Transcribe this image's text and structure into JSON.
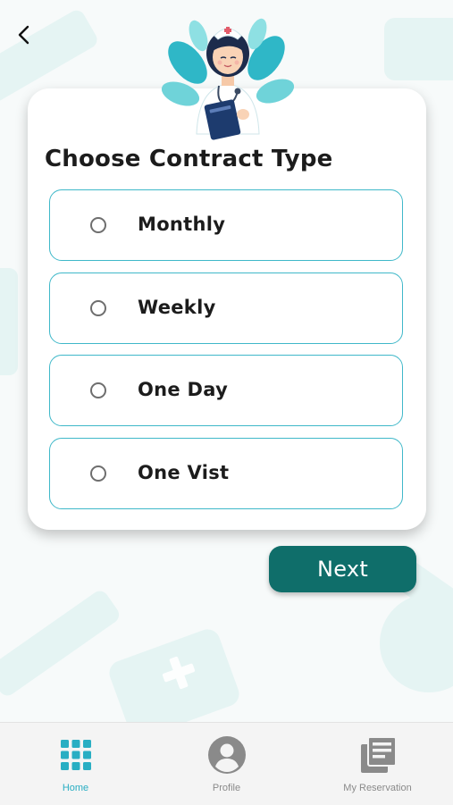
{
  "colors": {
    "accent": "#29aec3",
    "option_border": "#3fb8c9",
    "primary_button": "#0f6e6a",
    "nav_inactive": "#8a8a8a"
  },
  "header": {
    "back_icon": "chevron-left-icon"
  },
  "card": {
    "title": "Choose Contract Type",
    "illustration": "nurse-illustration",
    "options": [
      {
        "label": "Monthly",
        "selected": false
      },
      {
        "label": "Weekly",
        "selected": false
      },
      {
        "label": "One Day",
        "selected": false
      },
      {
        "label": "One Vist",
        "selected": false
      }
    ]
  },
  "actions": {
    "next_label": "Next"
  },
  "bottom_nav": {
    "items": [
      {
        "label": "Home",
        "icon": "grid-icon",
        "active": true
      },
      {
        "label": "Profile",
        "icon": "user-circle-icon",
        "active": false
      },
      {
        "label": "My Reservation",
        "icon": "documents-icon",
        "active": false
      }
    ]
  }
}
